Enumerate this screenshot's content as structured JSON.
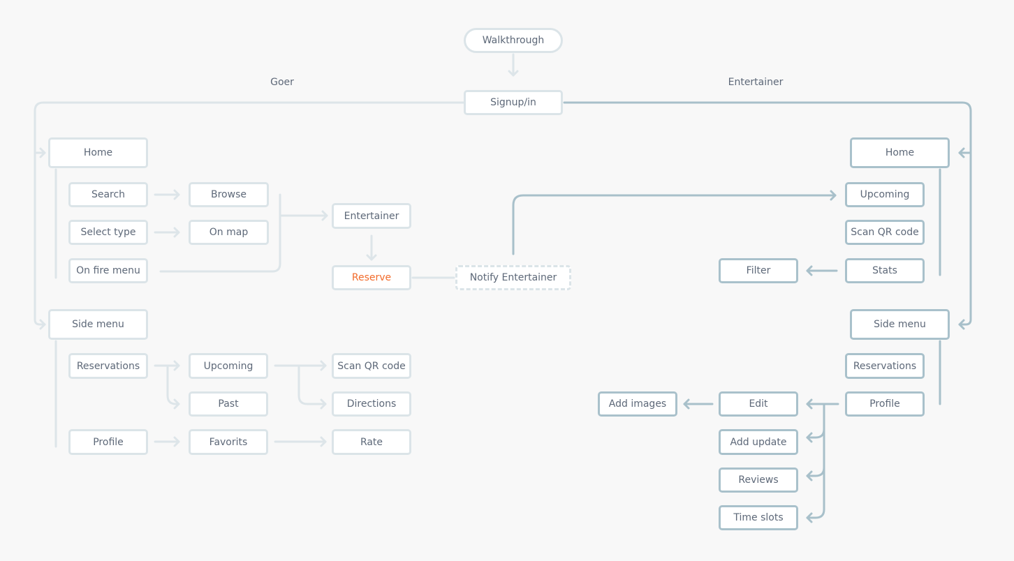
{
  "colors": {
    "goer_line": "#dde5e9",
    "entertainer_line": "#a8c0ca",
    "text": "#5d6878",
    "accent": "#f26b2b",
    "background": "#f8f8f8"
  },
  "labels": {
    "goer": "Goer",
    "entertainer": "Entertainer"
  },
  "top": {
    "walkthrough": "Walkthrough",
    "signup": "Signup/in"
  },
  "goer": {
    "home": "Home",
    "search": "Search",
    "browse": "Browse",
    "select_type": "Select type",
    "on_map": "On map",
    "on_fire_menu": "On fire menu",
    "entertainer": "Entertainer",
    "reserve": "Reserve",
    "notify_entertainer": "Notify Entertainer",
    "side_menu": "Side menu",
    "reservations": "Reservations",
    "upcoming": "Upcoming",
    "scan_qr": "Scan QR code",
    "past": "Past",
    "directions": "Directions",
    "profile": "Profile",
    "favorits": "Favorits",
    "rate": "Rate"
  },
  "entertainer": {
    "home": "Home",
    "upcoming": "Upcoming",
    "scan_qr": "Scan QR code",
    "stats": "Stats",
    "filter": "Filter",
    "side_menu": "Side menu",
    "reservations": "Reservations",
    "profile": "Profile",
    "edit": "Edit",
    "add_images": "Add images",
    "add_update": "Add update",
    "reviews": "Reviews",
    "time_slots": "Time slots"
  }
}
